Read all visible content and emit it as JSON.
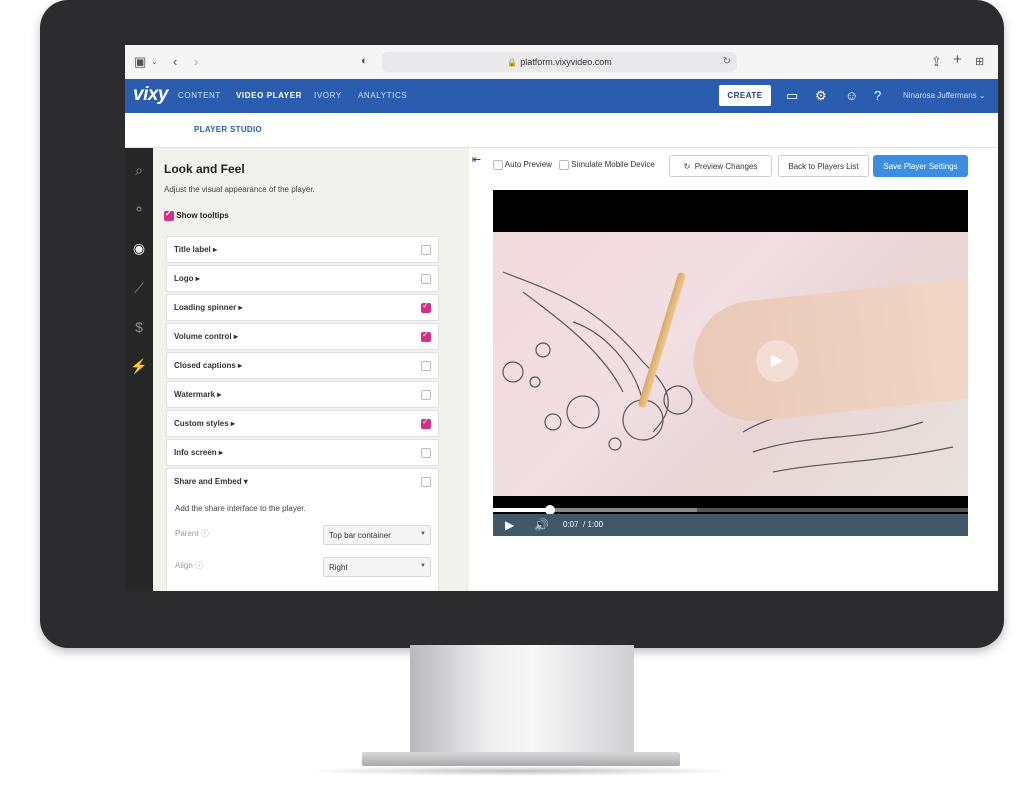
{
  "browser": {
    "url": "platform.vixyvideo.com",
    "icons": [
      "sidebar-toggle-icon",
      "chevron-down-icon",
      "back-arrow-icon",
      "forward-arrow-icon",
      "shield-icon",
      "lock-icon",
      "reload-icon",
      "share-icon",
      "new-tab-icon",
      "tab-grid-icon"
    ]
  },
  "nav": {
    "logo": "vixy",
    "items": [
      "CONTENT",
      "VIDEO PLAYER",
      "IVORY",
      "ANALYTICS"
    ],
    "active_index": 1,
    "create_label": "CREATE",
    "user_name": "Ninarosa Juffermans",
    "icons": [
      "folder-icon",
      "gear-icon",
      "user-icon",
      "help-icon",
      "chevron-down-icon"
    ],
    "brand_color": "#2a5db0"
  },
  "subnav": {
    "tab": "PLAYER STUDIO"
  },
  "rail": {
    "icons": [
      "search-icon",
      "palette-icon",
      "eye-icon",
      "chart-icon",
      "dollar-icon",
      "plugin-icon"
    ],
    "active": "eye-icon"
  },
  "panel": {
    "title": "Look and Feel",
    "subtitle": "Adjust the visual appearance of the player.",
    "show_tooltips_label": "Show tooltips",
    "show_tooltips_checked": true,
    "rows": [
      {
        "label": "Title label ▸",
        "checked": false
      },
      {
        "label": "Logo ▸",
        "checked": false
      },
      {
        "label": "Loading spinner ▸",
        "checked": true
      },
      {
        "label": "Volume control ▸",
        "checked": true
      },
      {
        "label": "Closed captions ▸",
        "checked": false
      },
      {
        "label": "Watermark ▸",
        "checked": false
      },
      {
        "label": "Custom styles ▸",
        "checked": true
      },
      {
        "label": "Info screen ▸",
        "checked": false
      },
      {
        "label": "Share and Embed ▾",
        "checked": false
      }
    ],
    "expanded": {
      "description": "Add the share interface to the player.",
      "parent_label": "Parent",
      "parent_value": "Top bar container",
      "align_label": "Align",
      "align_value": "Right"
    },
    "accent_color": "#d22f8e"
  },
  "toolbar": {
    "auto_preview_label": "Auto Preview",
    "simulate_mobile_label": "Simulate Mobile Device",
    "preview_changes_label": "Preview Changes",
    "back_label": "Back to Players List",
    "save_label": "Save Player Settings"
  },
  "player": {
    "current_time": "0:07",
    "duration": "/ 1:00",
    "progress_fraction": 0.12,
    "buffer_fraction": 0.43
  }
}
